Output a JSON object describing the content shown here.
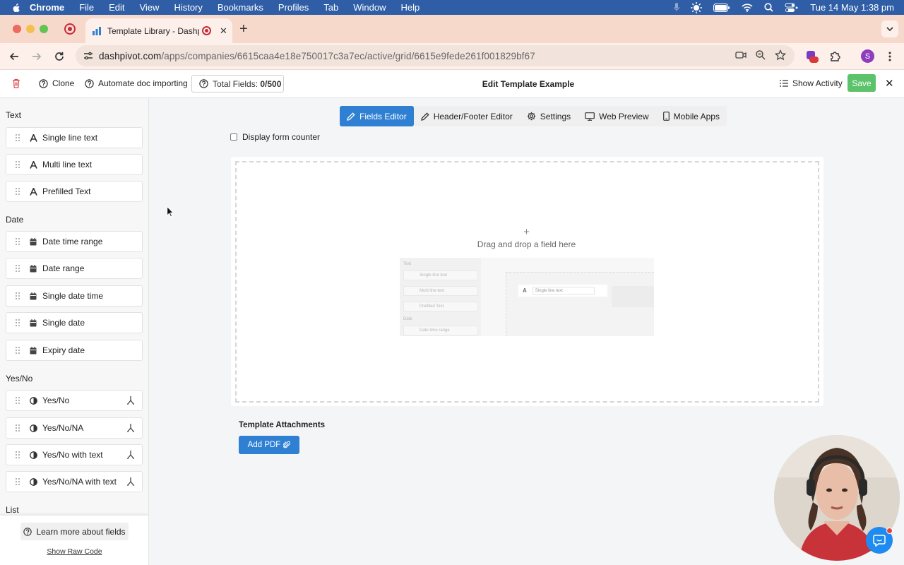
{
  "menubar": {
    "app": "Chrome",
    "items": [
      "File",
      "Edit",
      "View",
      "History",
      "Bookmarks",
      "Profiles",
      "Tab",
      "Window",
      "Help"
    ],
    "datetime": "Tue 14 May  1:38 pm"
  },
  "browser": {
    "tab_title": "Template Library - Dashpi",
    "url_host": "dashpivot.com",
    "url_path": "/apps/companies/6615caa4e18e750017c3a7ec/active/grid/6615e9fede261f001829bf67",
    "profile_initial": "S",
    "extension_badge": "9+"
  },
  "header": {
    "clone_label": "Clone",
    "automate_label": "Automate doc importing",
    "total_fields_label": "Total Fields:",
    "total_fields_value": "0/500",
    "title": "Edit Template Example",
    "show_activity_label": "Show Activity",
    "save_label": "Save"
  },
  "sidebar": {
    "sections": [
      {
        "label": "Text",
        "items": [
          {
            "label": "Single line text",
            "icon": "text-a-icon"
          },
          {
            "label": "Multi line text",
            "icon": "text-a-icon"
          },
          {
            "label": "Prefilled Text",
            "icon": "text-a-icon"
          }
        ]
      },
      {
        "label": "Date",
        "items": [
          {
            "label": "Date time range",
            "icon": "calendar-icon"
          },
          {
            "label": "Date range",
            "icon": "calendar-icon"
          },
          {
            "label": "Single date time",
            "icon": "calendar-icon"
          },
          {
            "label": "Single date",
            "icon": "calendar-icon"
          },
          {
            "label": "Expiry date",
            "icon": "calendar-icon"
          }
        ]
      },
      {
        "label": "Yes/No",
        "items": [
          {
            "label": "Yes/No",
            "icon": "half-circle-icon"
          },
          {
            "label": "Yes/No/NA",
            "icon": "half-circle-icon"
          },
          {
            "label": "Yes/No with text",
            "icon": "half-circle-icon"
          },
          {
            "label": "Yes/No/NA with text",
            "icon": "half-circle-icon"
          }
        ]
      },
      {
        "label": "List",
        "items": []
      }
    ],
    "learn_more_label": "Learn more about fields",
    "raw_code_label": "Show Raw Code"
  },
  "editor": {
    "tabs": [
      {
        "label": "Fields Editor",
        "icon": "pencil-icon",
        "active": true
      },
      {
        "label": "Header/Footer Editor",
        "icon": "pencil-icon",
        "active": false
      },
      {
        "label": "Settings",
        "icon": "gear-icon",
        "active": false
      },
      {
        "label": "Web Preview",
        "icon": "monitor-icon",
        "active": false
      },
      {
        "label": "Mobile Apps",
        "icon": "phone-icon",
        "active": false
      }
    ],
    "display_counter_label": "Display form counter",
    "drop_plus": "+",
    "drop_text": "Drag and drop a field here",
    "preview": {
      "text_label": "Text",
      "items": [
        "Single line text",
        "Multi line text",
        "Prefilled Text"
      ],
      "date_label": "Date",
      "date_item": "Date time range",
      "row_letter": "A",
      "row_input": "Single line text"
    },
    "attachments_title": "Template Attachments",
    "add_pdf_label": "Add PDF"
  },
  "colors": {
    "primary": "#2f7fd3",
    "save": "#5cc36b",
    "menubar": "#2f5ea6",
    "tabstrip": "#f7d9cc"
  }
}
